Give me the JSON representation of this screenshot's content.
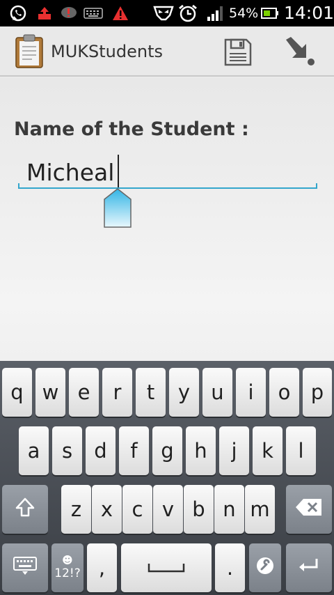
{
  "status_bar": {
    "battery_percent": "54%",
    "time": "14:01",
    "icons": [
      "whatsapp-icon",
      "upload-alert-icon",
      "chat-alert-icon",
      "keyboard-icon",
      "warning-icon",
      "mask-icon",
      "alarm-icon",
      "signal-icon",
      "battery-icon"
    ]
  },
  "action_bar": {
    "title": "MUKStudents",
    "icons": [
      "clipboard-app-icon",
      "save-icon",
      "download-icon"
    ]
  },
  "form": {
    "label": "Name of the Student :",
    "name_value": "Micheal"
  },
  "keyboard": {
    "row1": [
      "q",
      "w",
      "e",
      "r",
      "t",
      "y",
      "u",
      "i",
      "o",
      "p"
    ],
    "row2": [
      "a",
      "s",
      "d",
      "f",
      "g",
      "h",
      "j",
      "k",
      "l"
    ],
    "row3": [
      "z",
      "x",
      "c",
      "v",
      "b",
      "n",
      "m"
    ],
    "symbols_label": "12!?",
    "comma": ",",
    "period": "."
  },
  "colors": {
    "accent": "#33a6cc",
    "keyboard_bg": "#4a4f56"
  }
}
